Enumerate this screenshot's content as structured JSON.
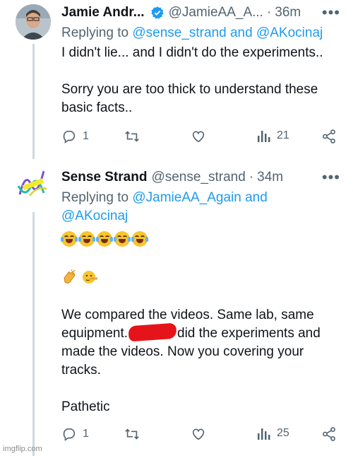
{
  "tweets": [
    {
      "author_name": "Jamie Andr...",
      "handle": "@JamieAA_A...",
      "time": "36m",
      "replying_prefix": "Replying to",
      "replying_to": "@sense_strand and @AKocinaj",
      "body": [
        "I didn't lie... and I didn't do the experiments..",
        "Sorry you are too thick to understand these basic facts.."
      ],
      "actions": {
        "replies": "1",
        "views": "21"
      }
    },
    {
      "author_name": "Sense Strand",
      "handle": "@sense_strand",
      "time": "34m",
      "replying_prefix": "Replying to",
      "replying_to_line1": "@JamieAA_Again and",
      "replying_to_line2": "@AKocinaj",
      "body_line1": "We compared the videos. Same lab, same",
      "body_line2_a": "equipment.",
      "body_line2_b": "did the experiments and",
      "body_line3": "made the videos. Now you covering your",
      "body_line4": "tracks.",
      "body_final": "Pathetic",
      "actions": {
        "replies": "1",
        "views": "25"
      }
    }
  ],
  "icons": {
    "verified": "verified-badge-icon",
    "more": "more-icon",
    "reply": "reply-icon",
    "retweet": "retweet-icon",
    "like": "like-icon",
    "views": "views-icon",
    "share": "share-icon"
  },
  "colors": {
    "link": "#1d9bf0",
    "verified": "#1d9bf0",
    "muted": "#536471",
    "redaction": "#e5141a"
  },
  "watermark": "imgflip.com"
}
